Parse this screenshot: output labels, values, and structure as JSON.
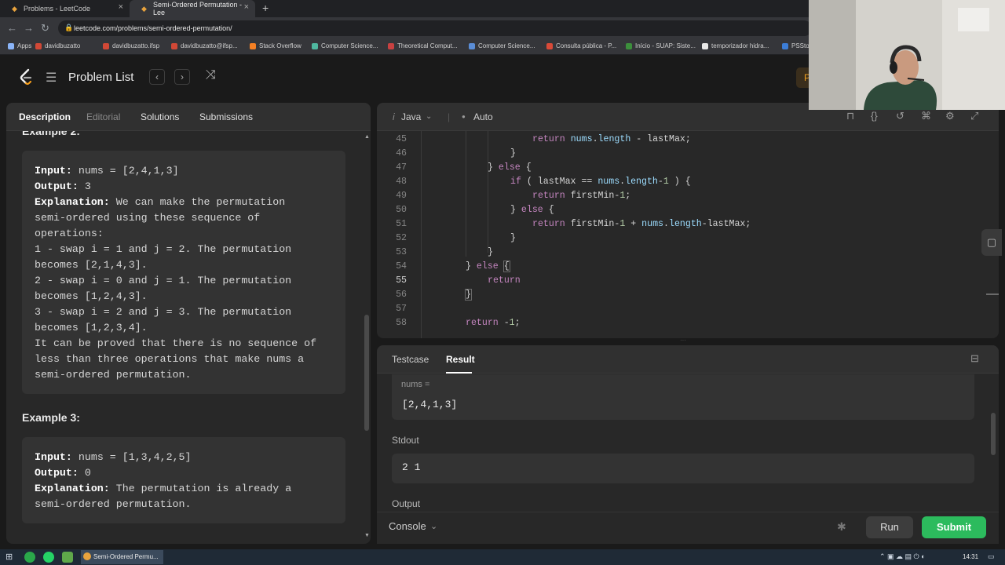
{
  "browser": {
    "tabs": [
      {
        "title": "Problems - LeetCode"
      },
      {
        "title": "Semi-Ordered Permutation - Lee"
      }
    ],
    "url": "leetcode.com/problems/semi-ordered-permutation/",
    "bookmarks": [
      "Apps",
      "davidbuzatto",
      "davidbuzatto.ifsp",
      "davidbuzatto@ifsp...",
      "Stack Overflow",
      "Computer Science...",
      "Theoretical Comput...",
      "Computer Science...",
      "Consulta pública - P...",
      "Início - SUAP: Siste...",
      "temporizador hidra...",
      "PSStore"
    ]
  },
  "nav": {
    "problem_list": "Problem List",
    "premium": "P"
  },
  "left_tabs": [
    "Description",
    "Editorial",
    "Solutions",
    "Submissions"
  ],
  "example2": {
    "header": "Example 2:",
    "input_label": "Input:",
    "input_value": "nums = [2,4,1,3]",
    "output_label": "Output:",
    "output_value": "3",
    "explanation_label": "Explanation:",
    "explanation_lines": [
      "We can make the permutation",
      "semi-ordered using these sequence of",
      "operations:",
      "1 - swap i = 1 and j = 2. The permutation",
      "becomes [2,1,4,3].",
      "2 - swap i = 0 and j = 1. The permutation",
      "becomes [1,2,4,3].",
      "3 - swap i = 2 and j = 3. The permutation",
      "becomes [1,2,3,4].",
      "It can be proved that there is no sequence of",
      "less than three operations that make nums a",
      "semi-ordered permutation."
    ]
  },
  "example3": {
    "header": "Example 3:",
    "input_label": "Input:",
    "input_value": "nums = [1,3,4,2,5]",
    "output_label": "Output:",
    "output_value": "0",
    "explanation_label": "Explanation:",
    "explanation_lines": [
      "The permutation is already a",
      "semi-ordered permutation."
    ]
  },
  "editor": {
    "language": "Java",
    "mode": "Auto",
    "lines": [
      {
        "n": "45",
        "text": "return nums.length - lastMax;"
      },
      {
        "n": "46",
        "text": "}"
      },
      {
        "n": "47",
        "text": "} else {"
      },
      {
        "n": "48",
        "text": "if ( lastMax == nums.length-1 ) {"
      },
      {
        "n": "49",
        "text": "return firstMin-1;"
      },
      {
        "n": "50",
        "text": "} else {"
      },
      {
        "n": "51",
        "text": "return firstMin-1 + nums.length-lastMax;"
      },
      {
        "n": "52",
        "text": "}"
      },
      {
        "n": "53",
        "text": "}"
      },
      {
        "n": "54",
        "text": "} else {"
      },
      {
        "n": "55",
        "text": "return"
      },
      {
        "n": "56",
        "text": "}"
      },
      {
        "n": "57",
        "text": ""
      },
      {
        "n": "58",
        "text": "return -1;"
      }
    ]
  },
  "result": {
    "tabs": [
      "Testcase",
      "Result"
    ],
    "input_label": "nums =",
    "input_value": "[2,4,1,3]",
    "stdout_label": "Stdout",
    "stdout_value": "2 1",
    "output_label": "Output"
  },
  "actions": {
    "console": "Console",
    "run": "Run",
    "submit": "Submit"
  },
  "taskbar": {
    "active_window": "Semi-Ordered Permu...",
    "time": "14:31"
  },
  "colors": {
    "accent_green": "#2cbb5d",
    "keyword": "#c586c0",
    "field": "#9cdcfe",
    "number": "#b5cea8"
  }
}
